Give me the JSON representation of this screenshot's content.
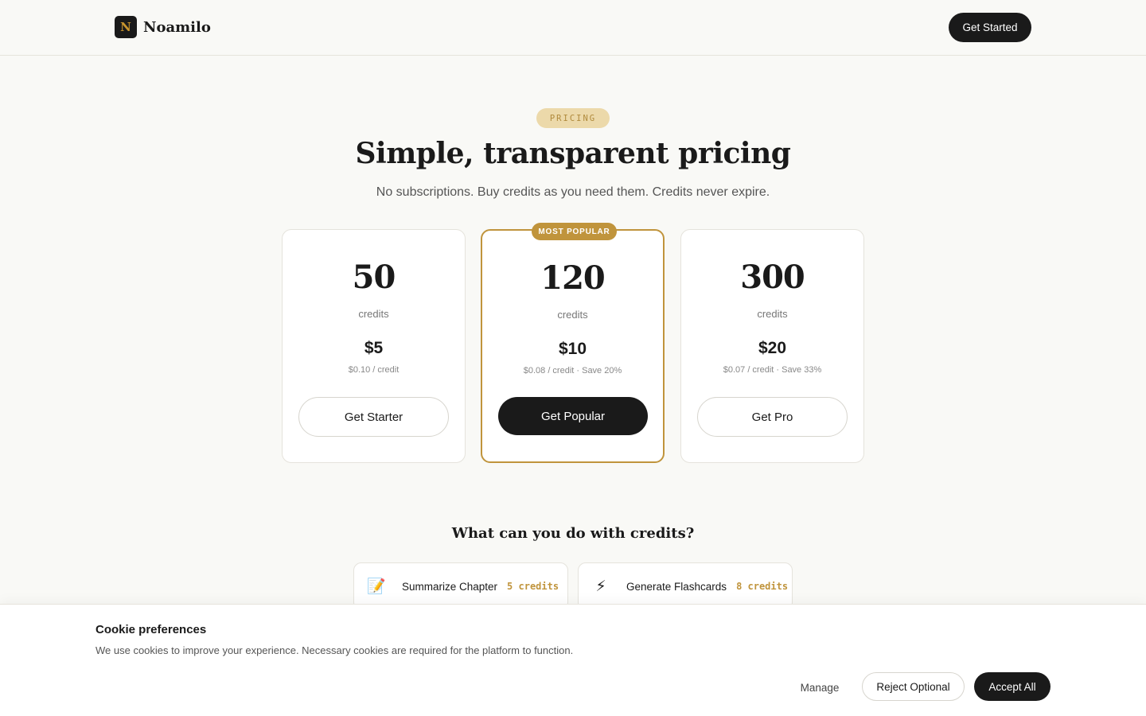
{
  "header": {
    "logo_letter": "N",
    "brand_name": "Noamilo",
    "cta_label": "Get Started"
  },
  "hero": {
    "pill": "PRICING",
    "title": "Simple, transparent pricing",
    "subtitle": "No subscriptions. Buy credits as you need them. Credits never expire."
  },
  "plans": [
    {
      "credits": "50",
      "credits_label": "credits",
      "price": "$5",
      "per_credit": "$0.10 / credit",
      "button": "Get Starter",
      "badge": ""
    },
    {
      "credits": "120",
      "credits_label": "credits",
      "price": "$10",
      "per_credit": "$0.08 / credit · Save 20%",
      "button": "Get Popular",
      "badge": "MOST POPULAR"
    },
    {
      "credits": "300",
      "credits_label": "credits",
      "price": "$20",
      "per_credit": "$0.07 / credit · Save 33%",
      "button": "Get Pro",
      "badge": ""
    }
  ],
  "usage": {
    "title": "What can you do with credits?",
    "items": [
      {
        "icon": "memo-icon",
        "glyph": "📝",
        "label": "Summarize Chapter",
        "cost": "5 credits"
      },
      {
        "icon": "lightning-icon",
        "glyph": "⚡",
        "label": "Generate Flashcards",
        "cost": "8 credits"
      }
    ]
  },
  "cookie": {
    "title": "Cookie preferences",
    "text": "We use cookies to improve your experience. Necessary cookies are required for the platform to function.",
    "manage": "Manage",
    "reject": "Reject Optional",
    "accept": "Accept All"
  },
  "colors": {
    "accent": "#c0943c",
    "dark": "#1a1a1a",
    "background": "#f9f9f6"
  }
}
